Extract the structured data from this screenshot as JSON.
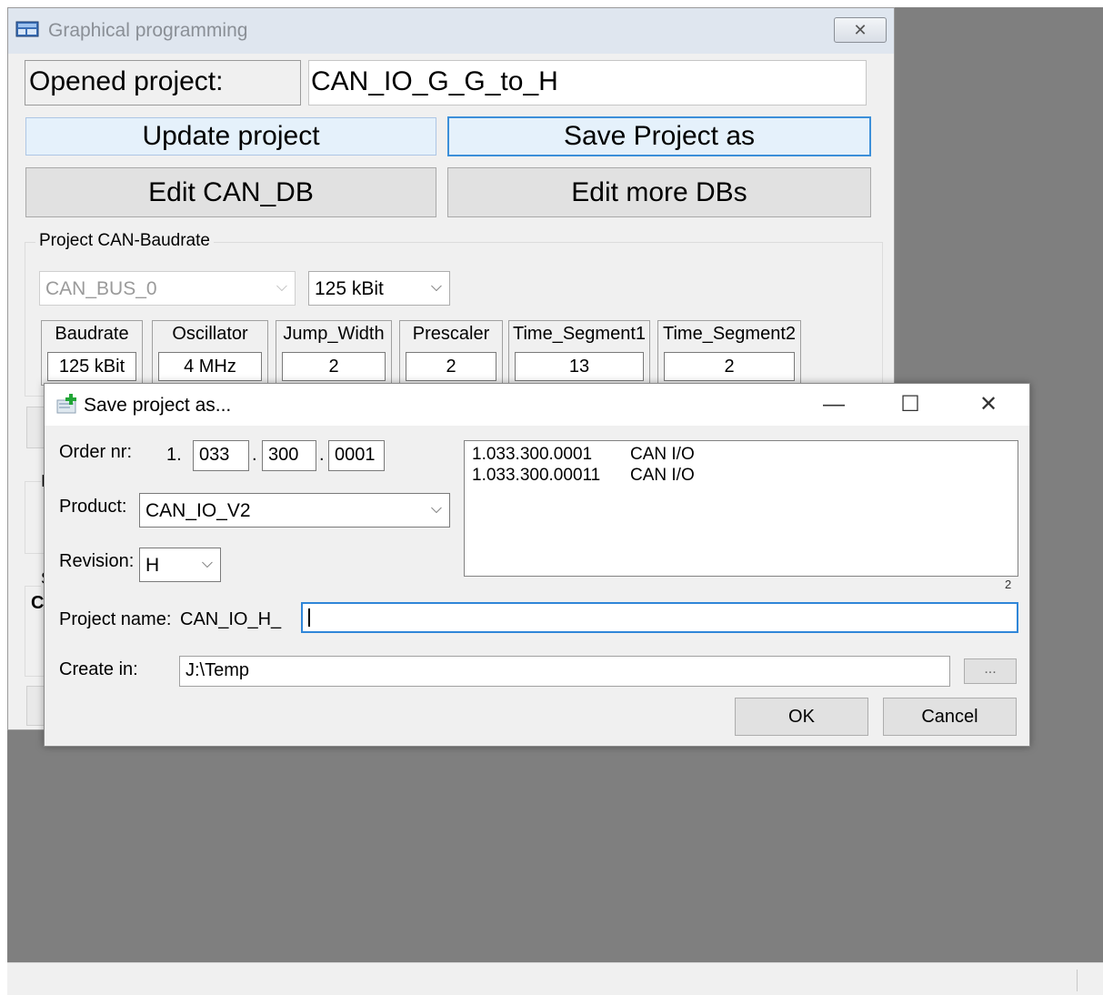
{
  "main_window": {
    "title": "Graphical programming",
    "close_glyph": "✕",
    "opened_project_label": "Opened project:",
    "opened_project_value": "CAN_IO_G_G_to_H",
    "buttons": {
      "update_project": "Update project",
      "save_project_as": "Save Project as",
      "edit_can_db": "Edit CAN_DB",
      "edit_more_dbs": "Edit more DBs"
    },
    "baudrate_group": {
      "legend": "Project CAN-Baudrate",
      "bus_select": "CAN_BUS_0",
      "baud_select": "125 kBit",
      "params": [
        {
          "label": "Baudrate",
          "value": "125 kBit"
        },
        {
          "label": "Oscillator",
          "value": "4 MHz"
        },
        {
          "label": "Jump_Width",
          "value": "2"
        },
        {
          "label": "Prescaler",
          "value": "2"
        },
        {
          "label": "Time_Segment1",
          "value": "13"
        },
        {
          "label": "Time_Segment2",
          "value": "2"
        }
      ]
    },
    "partial_glyphs": {
      "i": "I",
      "s": "S",
      "c": "C"
    }
  },
  "dialog": {
    "title": "Save project as...",
    "controls": {
      "minimize": "—",
      "maximize": "☐",
      "close": "✕"
    },
    "order_nr": {
      "label": "Order nr:",
      "prefix": "1.",
      "part1": "033",
      "part2": "300",
      "part3": "0001",
      "dot": "."
    },
    "product": {
      "label": "Product:",
      "value": "CAN_IO_V2"
    },
    "revision": {
      "label": "Revision:",
      "value": "H"
    },
    "list": [
      {
        "order": "1.033.300.0001",
        "name": "CAN I/O"
      },
      {
        "order": "1.033.300.00011",
        "name": "CAN I/O"
      }
    ],
    "list_count": "2",
    "project_name": {
      "label": "Project name:",
      "prefix": "CAN_IO_H_",
      "value": ""
    },
    "create_in": {
      "label": "Create in:",
      "value": "J:\\Temp",
      "browse": "..."
    },
    "ok": "OK",
    "cancel": "Cancel"
  },
  "icons": {
    "chevron": "⌵"
  }
}
